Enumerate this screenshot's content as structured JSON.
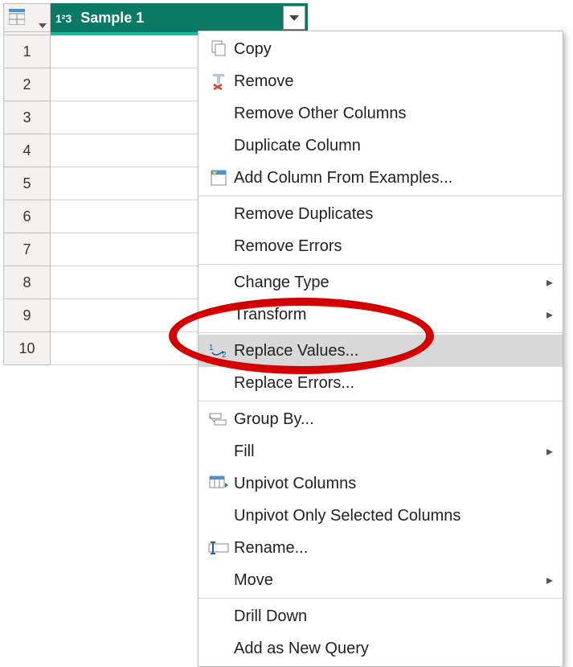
{
  "column": {
    "name": "Sample 1",
    "type_icon": "1²3"
  },
  "rows": [
    1,
    2,
    3,
    4,
    5,
    6,
    7,
    8,
    9,
    10
  ],
  "menu": {
    "groups": [
      [
        {
          "key": "copy",
          "label": "Copy",
          "icon": "copy"
        },
        {
          "key": "remove",
          "label": "Remove",
          "icon": "remove"
        },
        {
          "key": "remove_other",
          "label": "Remove Other Columns",
          "icon": ""
        },
        {
          "key": "duplicate",
          "label": "Duplicate Column",
          "icon": ""
        },
        {
          "key": "add_examples",
          "label": "Add Column From Examples...",
          "icon": "add-examples"
        }
      ],
      [
        {
          "key": "remove_dups",
          "label": "Remove Duplicates",
          "icon": ""
        },
        {
          "key": "remove_errors",
          "label": "Remove Errors",
          "icon": ""
        }
      ],
      [
        {
          "key": "change_type",
          "label": "Change Type",
          "icon": "",
          "sub": true
        },
        {
          "key": "transform",
          "label": "Transform",
          "icon": "",
          "sub": true
        }
      ],
      [
        {
          "key": "replace_values",
          "label": "Replace Values...",
          "icon": "replace",
          "highlight": true
        },
        {
          "key": "replace_errors",
          "label": "Replace Errors...",
          "icon": ""
        }
      ],
      [
        {
          "key": "group_by",
          "label": "Group By...",
          "icon": "group"
        },
        {
          "key": "fill",
          "label": "Fill",
          "icon": "",
          "sub": true
        },
        {
          "key": "unpivot",
          "label": "Unpivot Columns",
          "icon": "unpivot"
        },
        {
          "key": "unpivot_sel",
          "label": "Unpivot Only Selected Columns",
          "icon": ""
        },
        {
          "key": "rename",
          "label": "Rename...",
          "icon": "rename"
        },
        {
          "key": "move",
          "label": "Move",
          "icon": "",
          "sub": true
        }
      ],
      [
        {
          "key": "drill",
          "label": "Drill Down",
          "icon": ""
        },
        {
          "key": "new_query",
          "label": "Add as New Query",
          "icon": ""
        }
      ]
    ]
  }
}
